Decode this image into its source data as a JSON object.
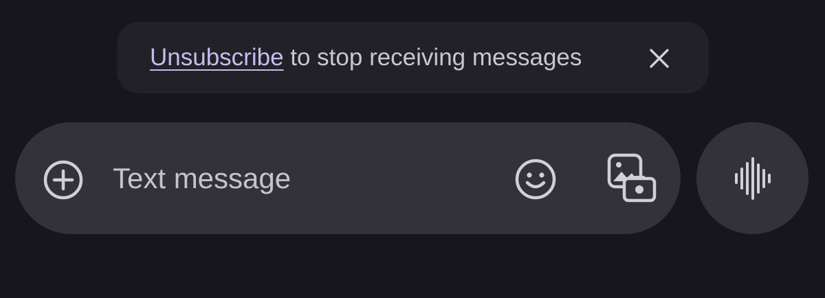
{
  "banner": {
    "link_label": "Unsubscribe",
    "message": " to stop receiving messages",
    "close_icon": "close-icon"
  },
  "compose": {
    "placeholder": "Text message",
    "value": "",
    "icons": {
      "add": "add-circle-icon",
      "emoji": "emoji-icon",
      "media": "gallery-camera-icon"
    }
  },
  "voice_button": {
    "icon": "voice-waveform-icon"
  },
  "colors": {
    "background": "#17161c",
    "banner_bg": "#222127",
    "compose_bg": "#333238",
    "link": "#c8bbf0",
    "text": "#c9c7cd",
    "icon": "#d2d0d6"
  }
}
